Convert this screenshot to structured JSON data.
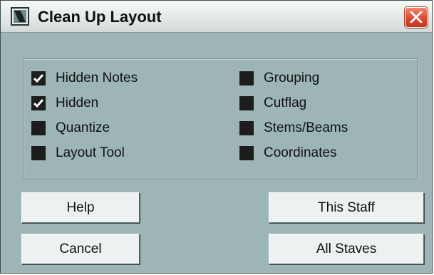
{
  "window": {
    "title": "Clean Up Layout",
    "icon": "app-icon",
    "close_icon": "close-icon"
  },
  "options": {
    "left": [
      {
        "label": "Hidden Notes",
        "checked": true
      },
      {
        "label": "Hidden",
        "checked": true
      },
      {
        "label": "Quantize",
        "checked": false
      },
      {
        "label": "Layout Tool",
        "checked": false
      }
    ],
    "right": [
      {
        "label": "Grouping",
        "checked": false
      },
      {
        "label": "Cutflag",
        "checked": false
      },
      {
        "label": "Stems/Beams",
        "checked": false
      },
      {
        "label": "Coordinates",
        "checked": false
      }
    ]
  },
  "buttons": {
    "help": "Help",
    "cancel": "Cancel",
    "this_staff": "This Staff",
    "all_staves": "All Staves"
  },
  "colors": {
    "window_bg": "#9db5b6",
    "checkbox_fill": "#1d1d1d",
    "close_button": "#d9452a"
  }
}
